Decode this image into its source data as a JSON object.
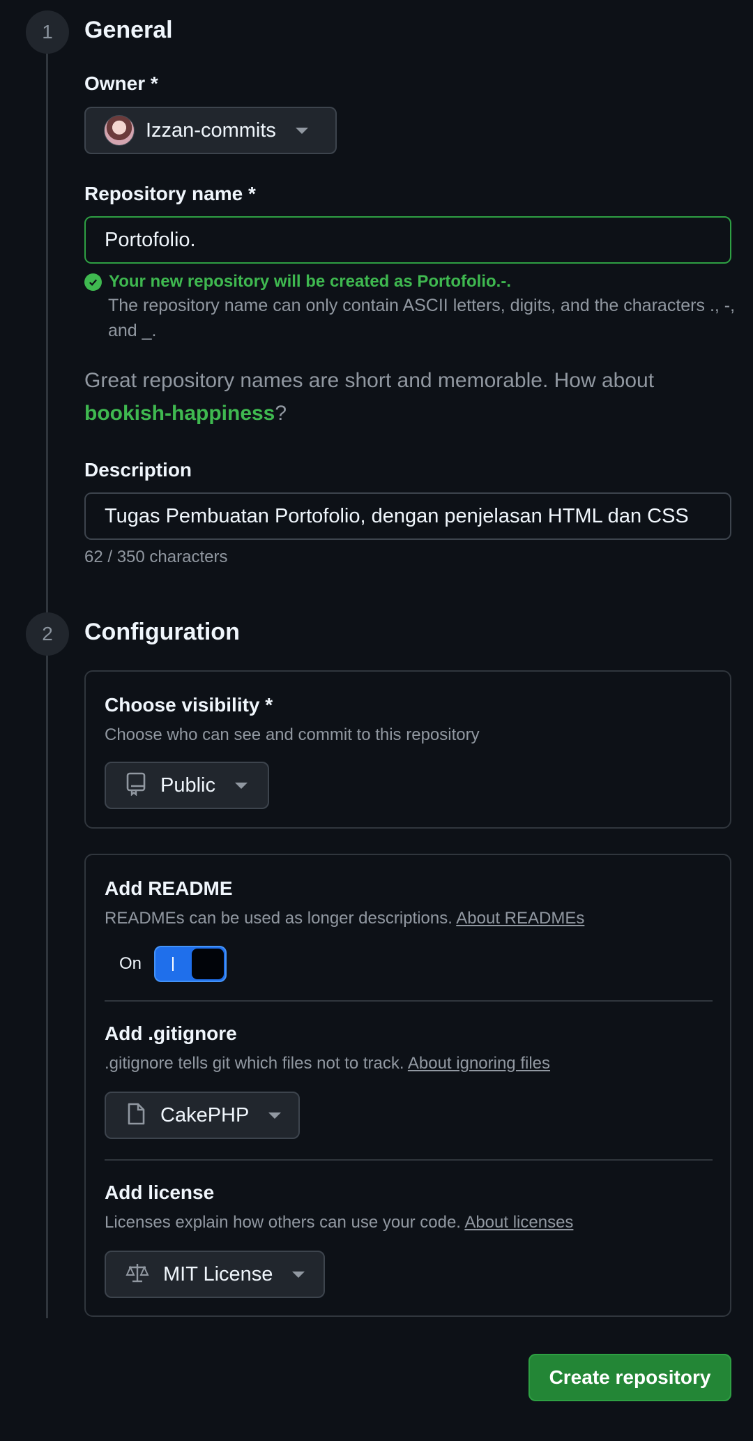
{
  "general": {
    "step_number": "1",
    "title": "General",
    "owner_label": "Owner *",
    "owner_name": "Izzan-commits",
    "repo_name_label": "Repository name *",
    "repo_name_value": "Portofolio.",
    "success_message": "Your new repository will be created as Portofolio.-.",
    "hint": "The repository name can only contain ASCII letters, digits, and the characters ., -, and _.",
    "suggestion_prefix": "Great repository names are short and memorable. How about ",
    "suggestion_name": "bookish-happiness",
    "suggestion_suffix": "?",
    "description_label": "Description",
    "description_value": "Tugas Pembuatan Portofolio, dengan penjelasan HTML dan CSS",
    "char_count": "62 / 350 characters"
  },
  "configuration": {
    "step_number": "2",
    "title": "Configuration",
    "visibility": {
      "title": "Choose visibility *",
      "description": "Choose who can see and commit to this repository",
      "selected": "Public",
      "icon": "repo-icon"
    },
    "readme": {
      "title": "Add README",
      "description": "READMEs can be used as longer descriptions. ",
      "link": "About READMEs",
      "toggle_label": "On",
      "enabled": true
    },
    "gitignore": {
      "title": "Add .gitignore",
      "description": ".gitignore tells git which files not to track. ",
      "link": "About ignoring files",
      "selected": "CakePHP",
      "icon": "file-icon"
    },
    "license": {
      "title": "Add license",
      "description": "Licenses explain how others can use your code. ",
      "link": "About licenses",
      "selected": "MIT License",
      "icon": "law-icon"
    }
  },
  "actions": {
    "create_label": "Create repository"
  },
  "colors": {
    "background": "#0d1117",
    "success": "#3fb950",
    "primary_button": "#238636",
    "toggle_on": "#1f6feb"
  }
}
